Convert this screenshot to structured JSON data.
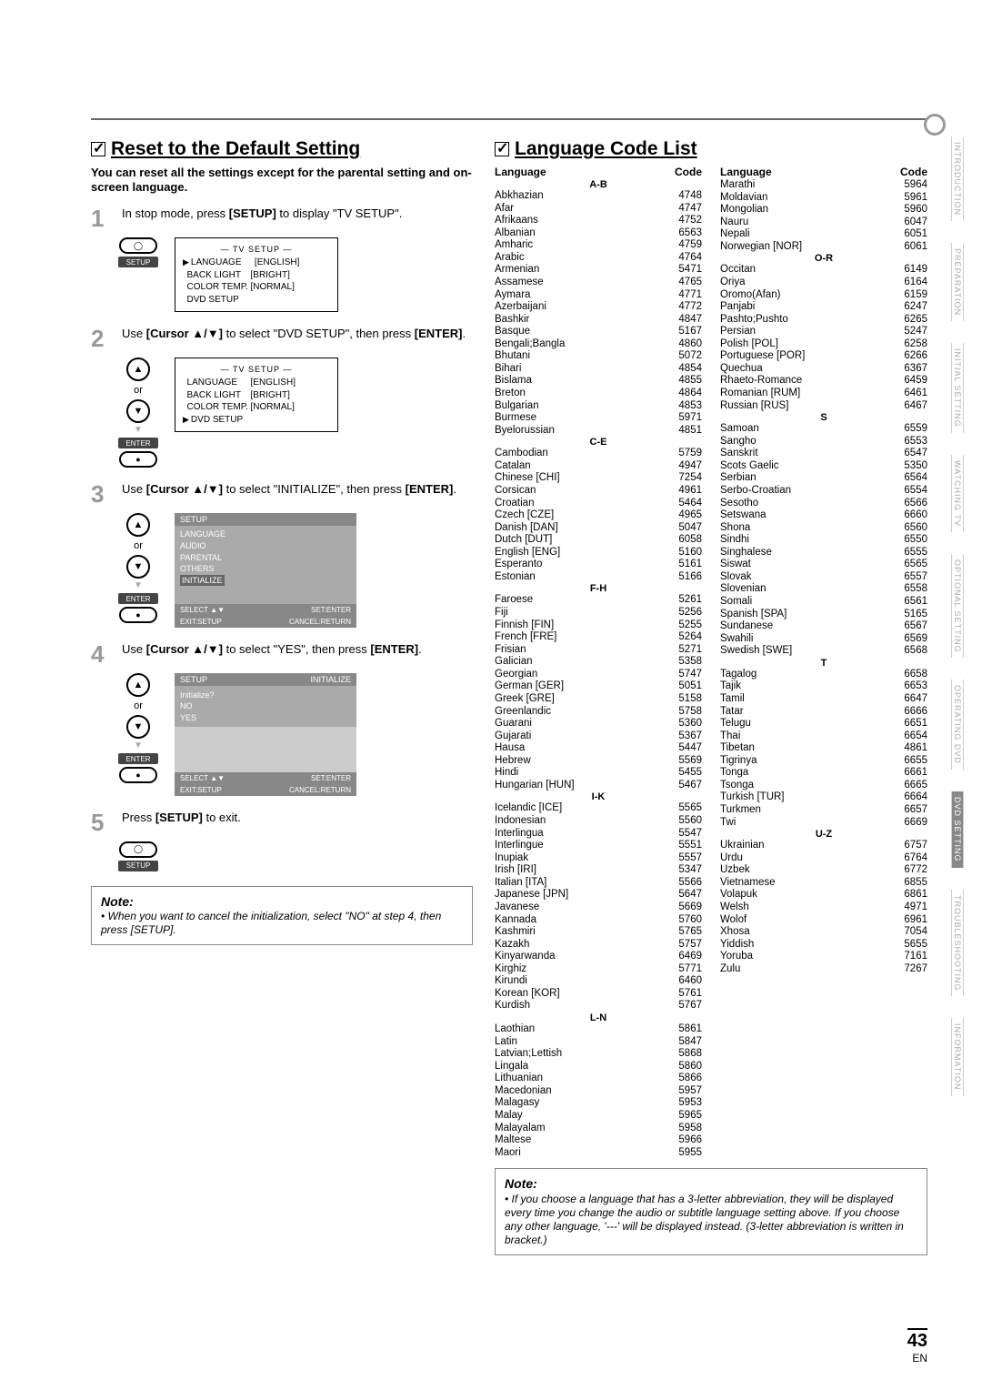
{
  "page": {
    "number": "43",
    "lang": "EN"
  },
  "side_tabs": [
    "INTRODUCTION",
    "PREPARATION",
    "INITIAL SETTING",
    "WATCHING TV",
    "OPTIONAL SETTING",
    "OPERATING DVD",
    "DVD SETTING",
    "TROUBLESHOOTING",
    "INFORMATION"
  ],
  "reset": {
    "title": "Reset to the Default Setting",
    "intro": "You can reset all the settings except for the parental setting and on-screen language.",
    "steps": [
      {
        "n": "1",
        "pre": "In stop mode, press ",
        "b1": "[SETUP]",
        "post": " to display \"TV SETUP\"."
      },
      {
        "n": "2",
        "pre": "Use ",
        "b1": "[Cursor ▲/▼]",
        "mid": " to select \"DVD SETUP\", then press ",
        "b2": "[ENTER]",
        "post": "."
      },
      {
        "n": "3",
        "pre": "Use ",
        "b1": "[Cursor ▲/▼]",
        "mid": " to select \"INITIALIZE\", then press ",
        "b2": "[ENTER]",
        "post": "."
      },
      {
        "n": "4",
        "pre": "Use ",
        "b1": "[Cursor ▲/▼]",
        "mid": " to select \"YES\", then press ",
        "b2": "[ENTER]",
        "post": "."
      },
      {
        "n": "5",
        "pre": "Press ",
        "b1": "[SETUP]",
        "post": " to exit."
      }
    ],
    "remote": {
      "setup": "SETUP",
      "enter": "ENTER",
      "or": "or"
    },
    "tv_setup_screen": {
      "title": "— TV SETUP —",
      "rows": [
        {
          "k": "LANGUAGE",
          "v": "[ENGLISH]"
        },
        {
          "k": "BACK LIGHT",
          "v": "[BRIGHT]"
        },
        {
          "k": "COLOR TEMP.",
          "v": "[NORMAL]"
        },
        {
          "k": "DVD SETUP",
          "v": ""
        }
      ]
    },
    "dvd_setup_screen": {
      "head": "SETUP",
      "items": [
        "LANGUAGE",
        "AUDIO",
        "PARENTAL",
        "OTHERS",
        "INITIALIZE"
      ],
      "foot_a": "SELECT ▲▼",
      "foot_b": "SET:ENTER",
      "foot_c": "EXIT:SETUP",
      "foot_d": "CANCEL:RETURN"
    },
    "init_screen": {
      "head_a": "SETUP",
      "head_b": "INITIALIZE",
      "q": "Initialize?",
      "no": "NO",
      "yes": "YES"
    },
    "note_title": "Note:",
    "note_body": "• When you want to cancel the initialization, select \"NO\" at step 4, then press [SETUP]."
  },
  "langlist": {
    "title": "Language Code List",
    "col_head_lang": "Language",
    "col_head_code": "Code",
    "left": [
      {
        "g": "A-B"
      },
      {
        "l": "Abkhazian",
        "c": "4748"
      },
      {
        "l": "Afar",
        "c": "4747"
      },
      {
        "l": "Afrikaans",
        "c": "4752"
      },
      {
        "l": "Albanian",
        "c": "6563"
      },
      {
        "l": "Amharic",
        "c": "4759"
      },
      {
        "l": "Arabic",
        "c": "4764"
      },
      {
        "l": "Armenian",
        "c": "5471"
      },
      {
        "l": "Assamese",
        "c": "4765"
      },
      {
        "l": "Aymara",
        "c": "4771"
      },
      {
        "l": "Azerbaijani",
        "c": "4772"
      },
      {
        "l": "Bashkir",
        "c": "4847"
      },
      {
        "l": "Basque",
        "c": "5167"
      },
      {
        "l": "Bengali;Bangla",
        "c": "4860"
      },
      {
        "l": "Bhutani",
        "c": "5072"
      },
      {
        "l": "Bihari",
        "c": "4854"
      },
      {
        "l": "Bislama",
        "c": "4855"
      },
      {
        "l": "Breton",
        "c": "4864"
      },
      {
        "l": "Bulgarian",
        "c": "4853"
      },
      {
        "l": "Burmese",
        "c": "5971"
      },
      {
        "l": "Byelorussian",
        "c": "4851"
      },
      {
        "g": "C-E"
      },
      {
        "l": "Cambodian",
        "c": "5759"
      },
      {
        "l": "Catalan",
        "c": "4947"
      },
      {
        "l": "Chinese [CHI]",
        "c": "7254"
      },
      {
        "l": "Corsican",
        "c": "4961"
      },
      {
        "l": "Croatian",
        "c": "5464"
      },
      {
        "l": "Czech [CZE]",
        "c": "4965"
      },
      {
        "l": "Danish [DAN]",
        "c": "5047"
      },
      {
        "l": "Dutch [DUT]",
        "c": "6058"
      },
      {
        "l": "English [ENG]",
        "c": "5160"
      },
      {
        "l": "Esperanto",
        "c": "5161"
      },
      {
        "l": "Estonian",
        "c": "5166"
      },
      {
        "g": "F-H"
      },
      {
        "l": "Faroese",
        "c": "5261"
      },
      {
        "l": "Fiji",
        "c": "5256"
      },
      {
        "l": "Finnish [FIN]",
        "c": "5255"
      },
      {
        "l": "French [FRE]",
        "c": "5264"
      },
      {
        "l": "Frisian",
        "c": "5271"
      },
      {
        "l": "Galician",
        "c": "5358"
      },
      {
        "l": "Georgian",
        "c": "5747"
      },
      {
        "l": "German [GER]",
        "c": "5051"
      },
      {
        "l": "Greek [GRE]",
        "c": "5158"
      },
      {
        "l": "Greenlandic",
        "c": "5758"
      },
      {
        "l": "Guarani",
        "c": "5360"
      },
      {
        "l": "Gujarati",
        "c": "5367"
      },
      {
        "l": "Hausa",
        "c": "5447"
      },
      {
        "l": "Hebrew",
        "c": "5569"
      },
      {
        "l": "Hindi",
        "c": "5455"
      },
      {
        "l": "Hungarian [HUN]",
        "c": "5467"
      },
      {
        "g": "I-K"
      },
      {
        "l": "Icelandic [ICE]",
        "c": "5565"
      },
      {
        "l": "Indonesian",
        "c": "5560"
      },
      {
        "l": "Interlingua",
        "c": "5547"
      },
      {
        "l": "Interlingue",
        "c": "5551"
      },
      {
        "l": "Inupiak",
        "c": "5557"
      },
      {
        "l": "Irish [IRI]",
        "c": "5347"
      },
      {
        "l": "Italian [ITA]",
        "c": "5566"
      },
      {
        "l": "Japanese [JPN]",
        "c": "5647"
      },
      {
        "l": "Javanese",
        "c": "5669"
      },
      {
        "l": "Kannada",
        "c": "5760"
      },
      {
        "l": "Kashmiri",
        "c": "5765"
      },
      {
        "l": "Kazakh",
        "c": "5757"
      },
      {
        "l": "Kinyarwanda",
        "c": "6469"
      },
      {
        "l": "Kirghiz",
        "c": "5771"
      },
      {
        "l": "Kirundi",
        "c": "6460"
      },
      {
        "l": "Korean [KOR]",
        "c": "5761"
      },
      {
        "l": "Kurdish",
        "c": "5767"
      },
      {
        "g": "L-N"
      },
      {
        "l": "Laothian",
        "c": "5861"
      },
      {
        "l": "Latin",
        "c": "5847"
      },
      {
        "l": "Latvian;Lettish",
        "c": "5868"
      },
      {
        "l": "Lingala",
        "c": "5860"
      },
      {
        "l": "Lithuanian",
        "c": "5866"
      },
      {
        "l": "Macedonian",
        "c": "5957"
      },
      {
        "l": "Malagasy",
        "c": "5953"
      },
      {
        "l": "Malay",
        "c": "5965"
      },
      {
        "l": "Malayalam",
        "c": "5958"
      },
      {
        "l": "Maltese",
        "c": "5966"
      },
      {
        "l": "Maori",
        "c": "5955"
      }
    ],
    "right": [
      {
        "l": "Marathi",
        "c": "5964"
      },
      {
        "l": "Moldavian",
        "c": "5961"
      },
      {
        "l": "Mongolian",
        "c": "5960"
      },
      {
        "l": "Nauru",
        "c": "6047"
      },
      {
        "l": "Nepali",
        "c": "6051"
      },
      {
        "l": "Norwegian [NOR]",
        "c": "6061"
      },
      {
        "g": "O-R"
      },
      {
        "l": "Occitan",
        "c": "6149"
      },
      {
        "l": "Oriya",
        "c": "6164"
      },
      {
        "l": "Oromo(Afan)",
        "c": "6159"
      },
      {
        "l": "Panjabi",
        "c": "6247"
      },
      {
        "l": "Pashto;Pushto",
        "c": "6265"
      },
      {
        "l": "Persian",
        "c": "5247"
      },
      {
        "l": "Polish [POL]",
        "c": "6258"
      },
      {
        "l": "Portuguese [POR]",
        "c": "6266"
      },
      {
        "l": "Quechua",
        "c": "6367"
      },
      {
        "l": "Rhaeto-Romance",
        "c": "6459"
      },
      {
        "l": "Romanian [RUM]",
        "c": "6461"
      },
      {
        "l": "Russian [RUS]",
        "c": "6467"
      },
      {
        "g": "S"
      },
      {
        "l": "Samoan",
        "c": "6559"
      },
      {
        "l": "Sangho",
        "c": "6553"
      },
      {
        "l": "Sanskrit",
        "c": "6547"
      },
      {
        "l": "Scots Gaelic",
        "c": "5350"
      },
      {
        "l": "Serbian",
        "c": "6564"
      },
      {
        "l": "Serbo-Croatian",
        "c": "6554"
      },
      {
        "l": "Sesotho",
        "c": "6566"
      },
      {
        "l": "Setswana",
        "c": "6660"
      },
      {
        "l": "Shona",
        "c": "6560"
      },
      {
        "l": "Sindhi",
        "c": "6550"
      },
      {
        "l": "Singhalese",
        "c": "6555"
      },
      {
        "l": "Siswat",
        "c": "6565"
      },
      {
        "l": "Slovak",
        "c": "6557"
      },
      {
        "l": "Slovenian",
        "c": "6558"
      },
      {
        "l": "Somali",
        "c": "6561"
      },
      {
        "l": "Spanish [SPA]",
        "c": "5165"
      },
      {
        "l": "Sundanese",
        "c": "6567"
      },
      {
        "l": "Swahili",
        "c": "6569"
      },
      {
        "l": "Swedish [SWE]",
        "c": "6568"
      },
      {
        "g": "T"
      },
      {
        "l": "Tagalog",
        "c": "6658"
      },
      {
        "l": "Tajik",
        "c": "6653"
      },
      {
        "l": "Tamil",
        "c": "6647"
      },
      {
        "l": "Tatar",
        "c": "6666"
      },
      {
        "l": "Telugu",
        "c": "6651"
      },
      {
        "l": "Thai",
        "c": "6654"
      },
      {
        "l": "Tibetan",
        "c": "4861"
      },
      {
        "l": "Tigrinya",
        "c": "6655"
      },
      {
        "l": "Tonga",
        "c": "6661"
      },
      {
        "l": "Tsonga",
        "c": "6665"
      },
      {
        "l": "Turkish [TUR]",
        "c": "6664"
      },
      {
        "l": "Turkmen",
        "c": "6657"
      },
      {
        "l": "Twi",
        "c": "6669"
      },
      {
        "g": "U-Z"
      },
      {
        "l": "Ukrainian",
        "c": "6757"
      },
      {
        "l": "Urdu",
        "c": "6764"
      },
      {
        "l": "Uzbek",
        "c": "6772"
      },
      {
        "l": "Vietnamese",
        "c": "6855"
      },
      {
        "l": "Volapuk",
        "c": "6861"
      },
      {
        "l": "Welsh",
        "c": "4971"
      },
      {
        "l": "Wolof",
        "c": "6961"
      },
      {
        "l": "Xhosa",
        "c": "7054"
      },
      {
        "l": "Yiddish",
        "c": "5655"
      },
      {
        "l": "Yoruba",
        "c": "7161"
      },
      {
        "l": "Zulu",
        "c": "7267"
      }
    ],
    "note_title": "Note:",
    "note_body": "• If you choose a language that has a 3-letter abbreviation, they will be displayed every time you change the audio or subtitle language setting above. If you choose any other language, '---' will be displayed instead. (3-letter abbreviation is written in bracket.)"
  }
}
